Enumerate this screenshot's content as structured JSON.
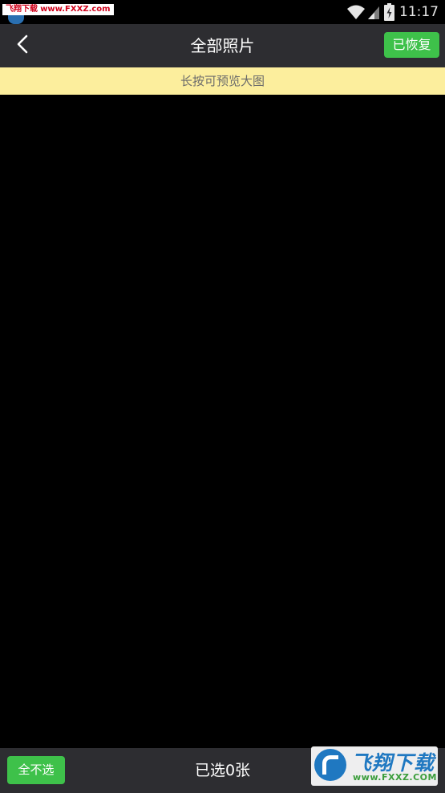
{
  "status_bar": {
    "watermark_part1": "飞翔下载",
    "watermark_part2": "www.FXXZ.com",
    "time": "11:17",
    "icons": [
      "wifi-icon",
      "signal-icon",
      "battery-charging-icon"
    ]
  },
  "header": {
    "back_icon": "chevron-left-icon",
    "title": "全部照片",
    "restored_label": "已恢复"
  },
  "hint": {
    "text": "长按可预览大图"
  },
  "bottom_bar": {
    "deselect_all_label": "全不选",
    "selected_count_text": "已选0张"
  },
  "watermark": {
    "title": "飞翔下载",
    "url": "www.FXXZ.COM"
  },
  "colors": {
    "accent_green": "#3ec14a",
    "bar_background": "#2d2d31",
    "hint_background": "#fcee9d",
    "content_background": "#000000"
  }
}
